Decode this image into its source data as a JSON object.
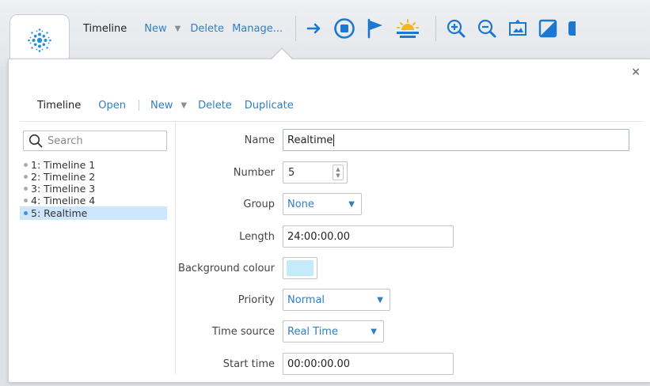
{
  "toolbar": {
    "title": "Timeline",
    "new_label": "New",
    "delete_label": "Delete",
    "manage_label": "Manage...",
    "icons": [
      "arrow-right-icon",
      "stop-icon",
      "flag-icon",
      "sunrise-icon",
      "zoom-in-icon",
      "zoom-out-icon",
      "fit-view-icon",
      "contrast-icon"
    ]
  },
  "panel": {
    "close_glyph": "×",
    "subtoolbar": {
      "title": "Timeline",
      "open_label": "Open",
      "new_label": "New",
      "delete_label": "Delete",
      "duplicate_label": "Duplicate"
    },
    "search": {
      "placeholder": "Search"
    },
    "timelines": [
      {
        "label": "1: Timeline 1",
        "selected": false
      },
      {
        "label": "2: Timeline 2",
        "selected": false
      },
      {
        "label": "3: Timeline 3",
        "selected": false
      },
      {
        "label": "4: Timeline 4",
        "selected": false
      },
      {
        "label": "5: Realtime",
        "selected": true
      }
    ],
    "form": {
      "name": {
        "label": "Name",
        "value": "Realtime"
      },
      "number": {
        "label": "Number",
        "value": "5"
      },
      "group": {
        "label": "Group",
        "value": "None"
      },
      "length": {
        "label": "Length",
        "value": "24:00:00.00"
      },
      "background": {
        "label": "Background colour",
        "color": "#c5eaf9"
      },
      "priority": {
        "label": "Priority",
        "value": "Normal"
      },
      "time_source": {
        "label": "Time source",
        "value": "Real Time"
      },
      "start_time": {
        "label": "Start time",
        "value": "00:00:00.00"
      }
    }
  },
  "colors": {
    "accent": "#2f7fc1",
    "selection": "#cde6fb",
    "logo": "#2a8fd9"
  }
}
